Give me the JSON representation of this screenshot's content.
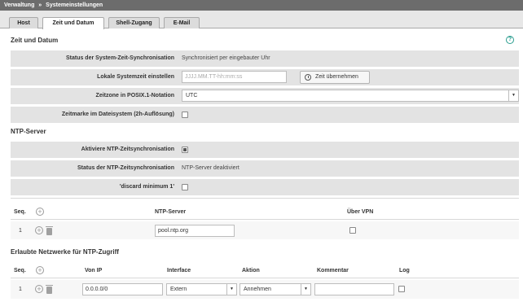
{
  "breadcrumb": {
    "root": "Verwaltung",
    "separator": "»",
    "current": "Systemeinstellungen"
  },
  "tabs": [
    {
      "label": "Host",
      "active": false
    },
    {
      "label": "Zeit und Datum",
      "active": true
    },
    {
      "label": "Shell-Zugang",
      "active": false
    },
    {
      "label": "E-Mail",
      "active": false
    }
  ],
  "zeit": {
    "title": "Zeit und Datum",
    "help_icon": "help-icon",
    "sync_status_label": "Status der System-Zeit-Synchronisation",
    "sync_status_value": "Synchronisiert per eingebauter Uhr",
    "local_time_label": "Lokale Systemzeit einstellen",
    "local_time_placeholder": "JJJJ.MM.TT-hh:mm:ss",
    "apply_time_button": "Zeit übernehmen",
    "timezone_label": "Zeitzone in POSIX.1-Notation",
    "timezone_value": "UTC",
    "fs_timestamp_label": "Zeitmarke im Dateisystem (2h-Auflösung)",
    "fs_timestamp_checked": false
  },
  "ntp": {
    "title": "NTP-Server",
    "activate_label": "Aktiviere NTP-Zeitsynchronisation",
    "activate_checked": true,
    "status_label": "Status der NTP-Zeitsynchronisation",
    "status_value": "NTP-Server deaktiviert",
    "discard_label": "'discard minimum 1'",
    "discard_checked": false,
    "table": {
      "headers": {
        "seq": "Seq.",
        "server": "NTP-Server",
        "vpn": "Über VPN"
      },
      "rows": [
        {
          "seq": "1",
          "server": "pool.ntp.org",
          "vpn": false
        }
      ]
    }
  },
  "networks": {
    "title": "Erlaubte Netzwerke für NTP-Zugriff",
    "headers": {
      "seq": "Seq.",
      "von_ip": "Von IP",
      "interface": "Interface",
      "aktion": "Aktion",
      "kommentar": "Kommentar",
      "log": "Log"
    },
    "rows": [
      {
        "seq": "1",
        "von_ip": "0.0.0.0/0",
        "interface": "Extern",
        "aktion": "Annehmen",
        "kommentar": "",
        "log": false
      }
    ]
  }
}
